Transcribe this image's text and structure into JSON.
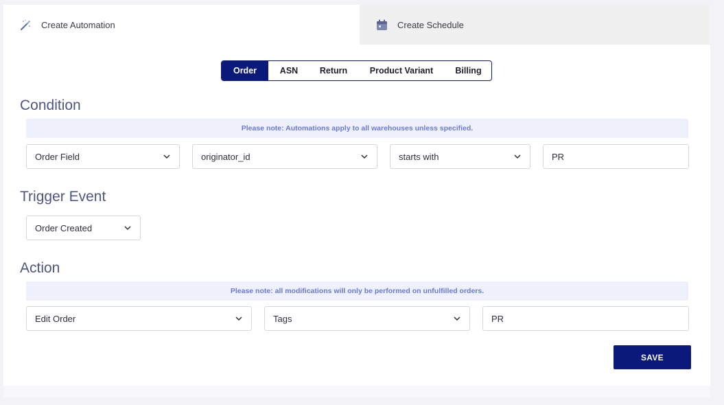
{
  "tabs": {
    "create_automation": "Create Automation",
    "create_schedule": "Create Schedule"
  },
  "segments": [
    "Order",
    "ASN",
    "Return",
    "Product Variant",
    "Billing"
  ],
  "active_segment": "Order",
  "condition": {
    "title": "Condition",
    "note": "Please note: Automations apply to all warehouses unless specified.",
    "field_type": "Order Field",
    "field": "originator_id",
    "operator": "starts with",
    "value": "PR"
  },
  "trigger": {
    "title": "Trigger Event",
    "event": "Order Created"
  },
  "action": {
    "title": "Action",
    "note": "Please note: all modifications will only be performed on unfulfilled orders.",
    "type": "Edit Order",
    "target": "Tags",
    "value": "PR"
  },
  "save_label": "SAVE",
  "colors": {
    "primary": "#0b1a7a",
    "section_title": "#4d5581",
    "note_bg": "#eef0fb",
    "note_text": "#6a7ad6"
  },
  "icons": {
    "automation": "magic-wand-icon",
    "schedule": "calendar-icon",
    "dropdown": "chevron-down-icon"
  }
}
